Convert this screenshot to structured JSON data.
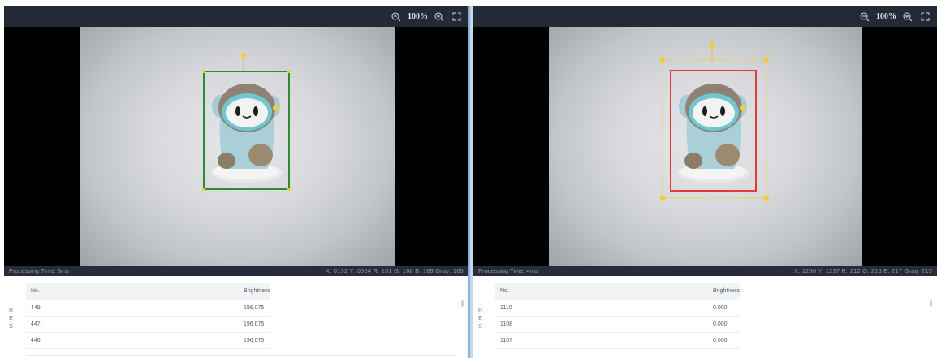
{
  "left": {
    "toolbar": {
      "zoom": "100%"
    },
    "status": {
      "processing": "Processing Time: 3ms",
      "pixel_info": "X: 0132  Y: 0504  R: 161  G: 166  B: 169  Gray: 165"
    },
    "results": {
      "tab_label": "R E S",
      "headers": [
        "No.",
        "Brightness"
      ],
      "rows": [
        {
          "no": "449",
          "brightness": "196.075"
        },
        {
          "no": "447",
          "brightness": "196.075"
        },
        {
          "no": "446",
          "brightness": "196.075"
        }
      ]
    },
    "roi_color": "#2e8b2e"
  },
  "right": {
    "toolbar": {
      "zoom": "100%"
    },
    "status": {
      "processing": "Processing Time: 4ms",
      "pixel_info": "X: 1290  Y: 1237  R: 212  G: 216  B: 217  Gray: 215"
    },
    "results": {
      "tab_label": "R E S",
      "headers": [
        "No.",
        "Brightness"
      ],
      "rows": [
        {
          "no": "1110",
          "brightness": "0.000"
        },
        {
          "no": "1108",
          "brightness": "0.000"
        },
        {
          "no": "1107",
          "brightness": "0.000"
        }
      ]
    },
    "roi_color": "#e03b3b",
    "handle_color": "#f2cf1e"
  },
  "icons": [
    "zoom-out-icon",
    "zoom-in-icon",
    "fullscreen-icon"
  ]
}
